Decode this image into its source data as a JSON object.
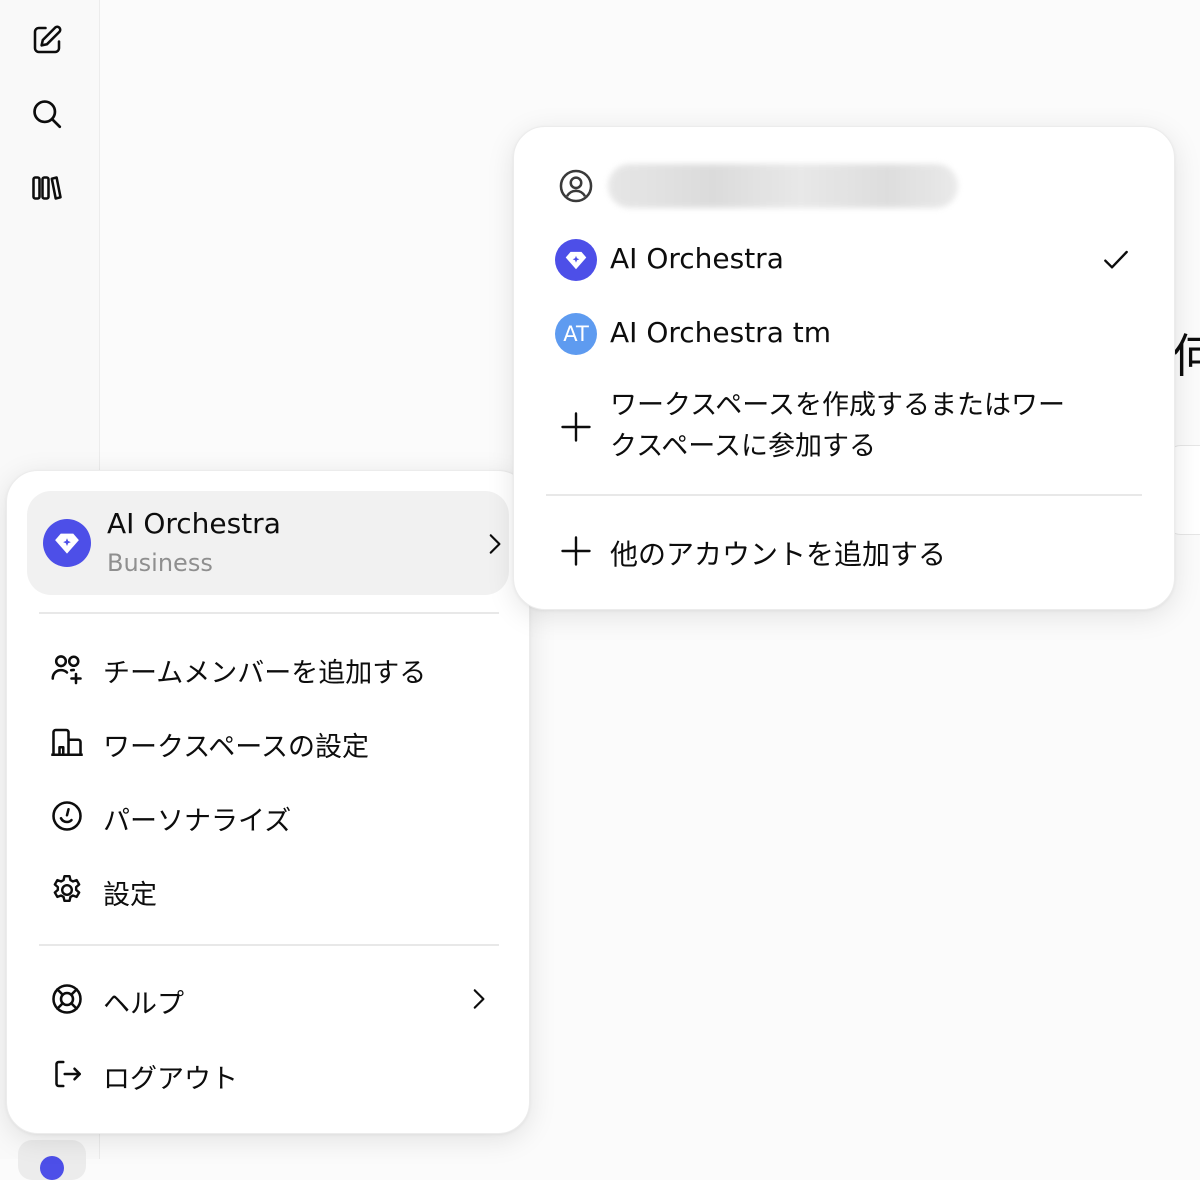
{
  "rail": {
    "icons": [
      "new-chat-icon",
      "search-icon",
      "library-icon"
    ]
  },
  "background": {
    "partial_text": "何"
  },
  "menu": {
    "account": {
      "name": "AI Orchestra",
      "plan": "Business"
    },
    "items": [
      {
        "icon": "add-team-member-icon",
        "label": "チームメンバーを追加する"
      },
      {
        "icon": "workspace-settings-icon",
        "label": "ワークスペースの設定"
      },
      {
        "icon": "personalize-icon",
        "label": "パーソナライズ"
      },
      {
        "icon": "gear-icon",
        "label": "設定"
      }
    ],
    "footer_items": [
      {
        "icon": "help-icon",
        "label": "ヘルプ"
      },
      {
        "icon": "logout-icon",
        "label": "ログアウト"
      }
    ]
  },
  "switcher": {
    "workspaces": [
      {
        "name": "AI Orchestra",
        "selected": true,
        "badge_color": "#4d4fe8"
      },
      {
        "name": "AI Orchestra tm",
        "initials": "AT",
        "selected": false,
        "badge_color": "#5e9bf0"
      }
    ],
    "create_join_label": "ワークスペースを作成するまたはワークスペースに参加する",
    "add_account_label": "他のアカウントを追加する"
  },
  "colors": {
    "accent": "#4d4fe8",
    "secondary_badge": "#5e9bf0",
    "muted_text": "#8f8f8f"
  }
}
